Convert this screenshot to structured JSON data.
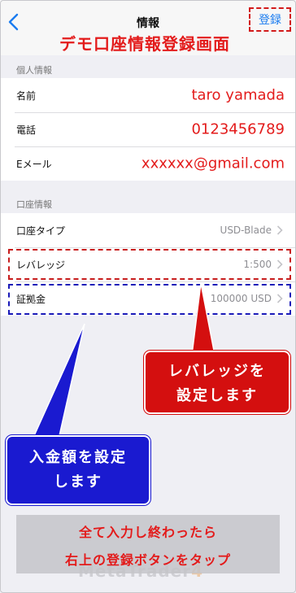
{
  "nav": {
    "title": "情報",
    "register_label": "登録"
  },
  "caption": "デモ口座情報登録画面",
  "personal": {
    "header": "個人情報",
    "rows": [
      {
        "label": "名前",
        "value": "taro yamada"
      },
      {
        "label": "電話",
        "value": "0123456789"
      },
      {
        "label": "Eメール",
        "value": "xxxxxx@gmail.com"
      }
    ]
  },
  "account": {
    "header": "口座情報",
    "rows": [
      {
        "label": "口座タイプ",
        "value": "USD-Blade"
      },
      {
        "label": "レバレッジ",
        "value": "1:500"
      },
      {
        "label": "証拠金",
        "value": "100000 USD"
      }
    ]
  },
  "callouts": {
    "leverage_line1": "レバレッジを",
    "leverage_line2": "設定します",
    "deposit_line1": "入金額を設定",
    "deposit_line2": "します"
  },
  "bottom_note": {
    "line1": "全て入力し終わったら",
    "line2": "右上の登録ボタンをタップ"
  },
  "watermark": {
    "text": "MetaTrader",
    "number": "4"
  },
  "colors": {
    "accent_blue": "#1a7cf0",
    "annotation_red": "#e31b1b",
    "annotation_blue": "#1a1ad0"
  }
}
